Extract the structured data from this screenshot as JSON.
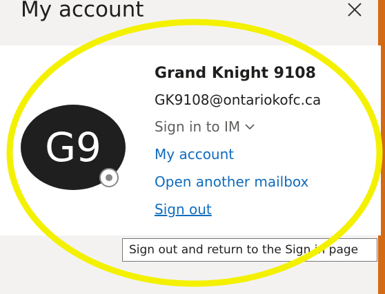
{
  "header": {
    "title": "My account",
    "close_icon": "close-icon"
  },
  "account": {
    "avatar_initials": "G9",
    "name": "Grand Knight 9108",
    "email": "GK9108@ontariokofc.ca",
    "im_status": "Sign in to IM",
    "im_chevron_icon": "chevron-down-icon",
    "presence_icon": "presence-offline-icon"
  },
  "links": {
    "my_account": "My account",
    "open_mailbox": "Open another mailbox",
    "sign_out": "Sign out"
  },
  "tooltip": {
    "text": "Sign out and return to the Sign in page"
  },
  "colors": {
    "accent_link": "#0f6cbd",
    "highlight_ring": "#f3f000",
    "avatar_bg": "#1f1f1f",
    "right_accent": "#d46a13"
  }
}
